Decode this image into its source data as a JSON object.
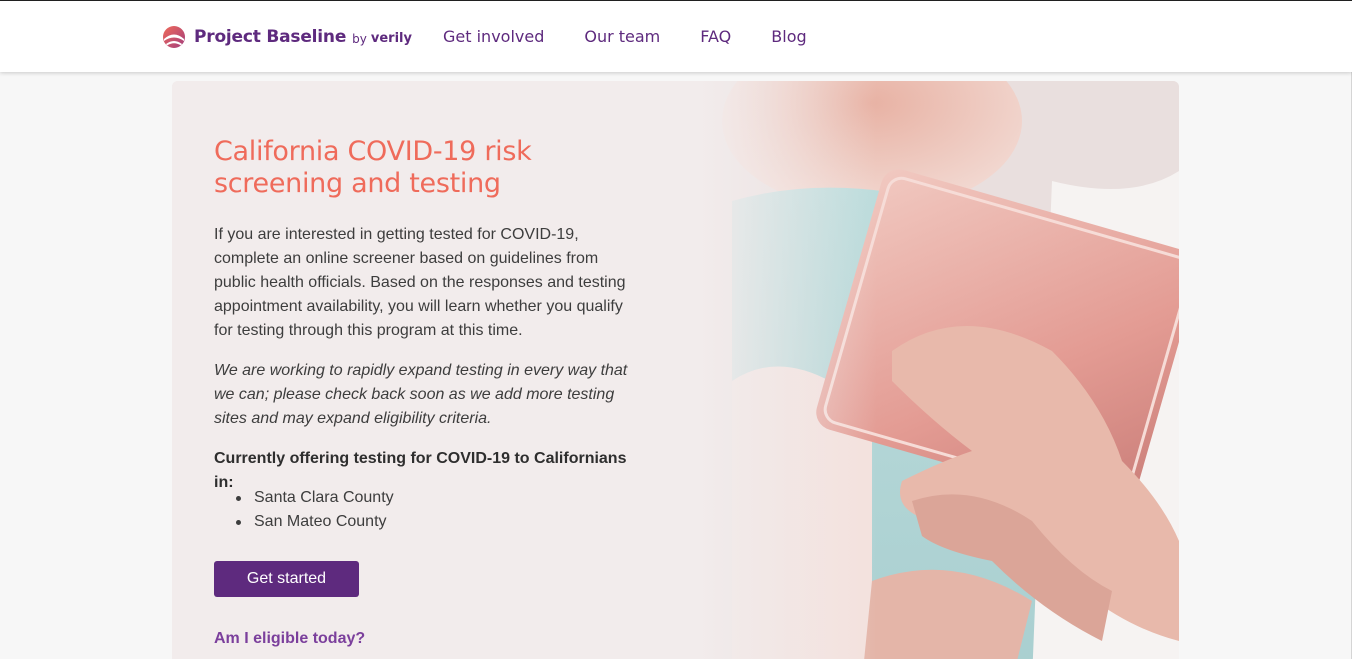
{
  "header": {
    "brand": {
      "name": "Project Baseline",
      "by": "by",
      "partner": "verily",
      "logo_icon": "project-baseline-logo"
    },
    "nav": [
      {
        "label": "Get involved"
      },
      {
        "label": "Our team"
      },
      {
        "label": "FAQ"
      },
      {
        "label": "Blog"
      }
    ]
  },
  "hero": {
    "title": "California COVID-19 risk screening and testing",
    "intro": "If you are interested in getting tested for COVID-19, complete an online screener based on guidelines from public health officials. Based on the responses and testing appointment availability, you will learn whether you qualify for testing through this program at this time.",
    "note": "We are working to rapidly expand testing in every way that we can; please check back soon as we add more testing sites and may expand eligibility criteria.",
    "offering_heading": "Currently offering testing for COVID-19 to Californians in:",
    "counties": [
      "Santa Clara County",
      "San Mateo County"
    ],
    "cta_label": "Get started",
    "eligibility_link": "Am I eligible today?",
    "image": "photo-elderly-hands-holding-tablet"
  },
  "colors": {
    "brand_purple": "#5e2a7e",
    "title_coral": "#ef6b5b",
    "link_purple": "#7b3f9c",
    "hero_bg": "#f2ecec"
  }
}
